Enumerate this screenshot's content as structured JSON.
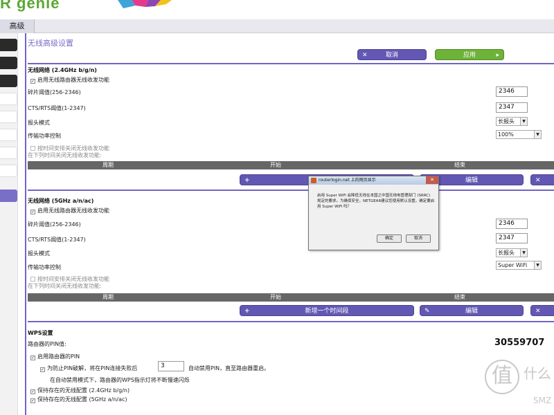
{
  "header": {
    "logo_text": "R genie"
  },
  "tabs": [
    {
      "label": "高级"
    }
  ],
  "page": {
    "title": "无线高级设置",
    "cancel_label": "取消",
    "apply_label": "应用"
  },
  "band24": {
    "heading": "无线网络 (2.4GHz b/g/n)",
    "enable_radio": "启用无线路由器无线收发功能",
    "frag_label": "碎片阈值(256-2346)",
    "frag_value": "2346",
    "cts_label": "CTS/RTS阈值(1-2347)",
    "cts_value": "2347",
    "preamble_label": "报头模式",
    "preamble_value": "长报头",
    "power_label": "传输功率控制",
    "power_value": "100%",
    "schedule_check": "按时间安排关闭无线收发功能",
    "schedule_note": "在下列时间关闭无线收发功能:",
    "col_period": "周期",
    "col_start": "开始",
    "col_end": "结束",
    "add_label": "新增一个时间段",
    "edit_label": "编辑",
    "add_partial": "新"
  },
  "band5": {
    "heading": "无线网络 (5GHz a/n/ac)",
    "enable_radio": "启用无线路由器无线收发功能",
    "frag_label": "碎片阈值(256-2346)",
    "frag_value": "2346",
    "cts_label": "CTS/RTS阈值(1-2347)",
    "cts_value": "2347",
    "preamble_label": "报头模式",
    "preamble_value": "长报头",
    "power_label": "传输功率控制",
    "power_value": "Super WiFi",
    "schedule_check": "按时间安排关闭无线收发功能",
    "schedule_note": "在下列时间关闭无线收发功能:",
    "col_period": "周期",
    "col_start": "开始",
    "col_end": "结束",
    "add_label": "新增一个时间段",
    "edit_label": "编辑"
  },
  "wps": {
    "heading": "WPS设置",
    "pin_label": "路由器的PIN值:",
    "pin_value": "30559707",
    "enable_pin": "启用路由器的PIN",
    "protect_text_1": "为防止PIN破解，将在PIN连接失败后",
    "protect_value": "3",
    "protect_text_2": "自动禁用PIN，直至路由器重启。",
    "protect_note": "在自动禁用模式下，路由器的WPS指示灯将不断慢速闪烁",
    "keep_24": "保持存在的无线配置 (2.4GHz b/g/n)",
    "keep_5": "保持存在的无线配置 (5GHz a/n/ac)"
  },
  "dialog": {
    "title": "routerlogin.net 上的网页显示",
    "body": "启用 Super WiFi 会降低无线在本国之中国无线电管理部门 (SRRC) 规定的要求。为确保安全，NETGEAR建议您使用默认设置。确定要启用 Super WiFi 吗？",
    "ok_label": "确定",
    "cancel_label": "取消",
    "close_glyph": "✕"
  },
  "watermark": {
    "seal": "值",
    "text1": "什么",
    "text2": "SMZ"
  },
  "icons": {
    "cancel": "x-icon",
    "apply": "arrow-right-icon",
    "add": "plus-icon",
    "edit": "pencil-icon",
    "delete": "x-icon"
  },
  "colors": {
    "accent": "#6f63c8",
    "apply_green": "#6fb23a",
    "button_purple": "#6258b4"
  }
}
